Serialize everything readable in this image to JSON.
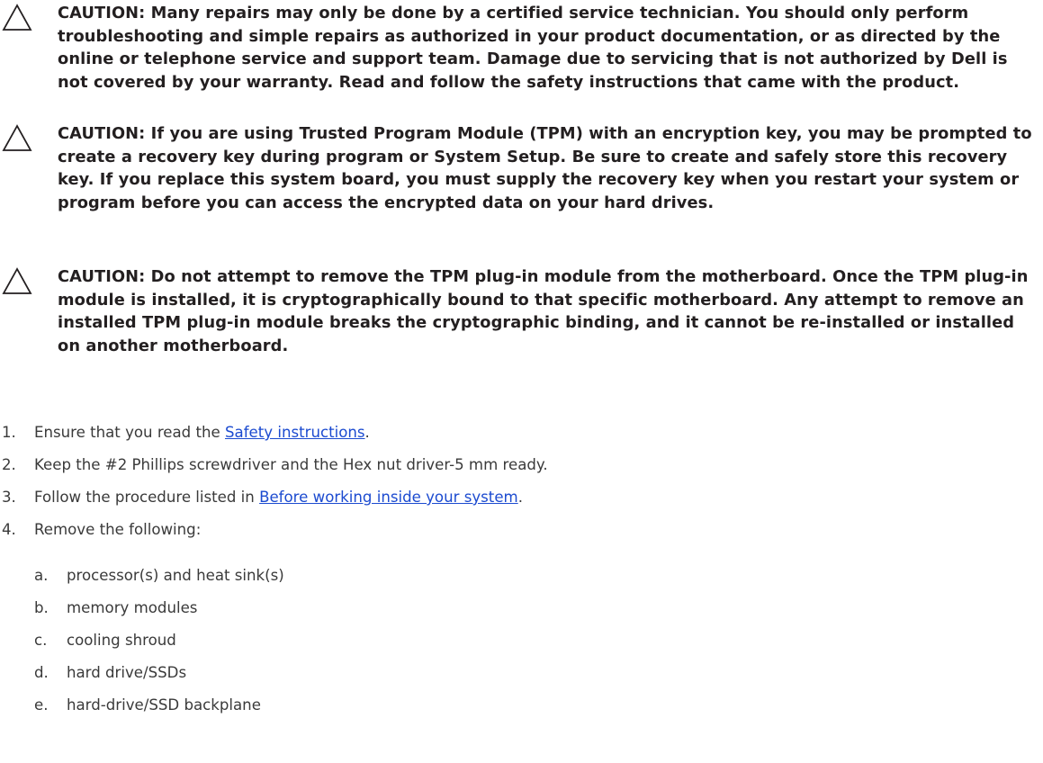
{
  "cautions": [
    {
      "icon": "caution-triangle-icon",
      "text": "CAUTION: Many repairs may only be done by a certified service technician. You should only perform troubleshooting and simple repairs as authorized in your product documentation, or as directed by the online or telephone service and support team. Damage due to servicing that is not authorized by Dell is not covered by your warranty. Read and follow the safety instructions that came with the product."
    },
    {
      "icon": "caution-triangle-icon",
      "text": "CAUTION: If you are using Trusted Program Module (TPM) with an encryption key, you may be prompted to create a recovery key during program or System Setup. Be sure to create and safely store this recovery key. If you replace this system board, you must supply the recovery key when you restart your system or program before you can access the encrypted data on your hard drives."
    },
    {
      "icon": "caution-triangle-icon",
      "text": "CAUTION: Do not attempt to remove the TPM plug-in module from the motherboard. Once the TPM plug-in module is installed, it is cryptographically bound to that specific motherboard. Any attempt to remove an installed TPM plug-in module breaks the cryptographic binding, and it cannot be re-installed or installed on another motherboard."
    }
  ],
  "steps": [
    {
      "num": "1.",
      "before": "Ensure that you read the ",
      "link": "Safety instructions",
      "after": "."
    },
    {
      "num": "2.",
      "text": "Keep the #2 Phillips screwdriver and the Hex nut driver-5 mm ready."
    },
    {
      "num": "3.",
      "before": "Follow the procedure listed in ",
      "link": "Before working inside your system",
      "after": "."
    },
    {
      "num": "4.",
      "text": "Remove the following:"
    }
  ],
  "substeps": [
    {
      "num": "a.",
      "text": "processor(s) and heat sink(s)"
    },
    {
      "num": "b.",
      "text": "memory modules"
    },
    {
      "num": "c.",
      "text": "cooling shroud"
    },
    {
      "num": "d.",
      "text": "hard drive/SSDs"
    },
    {
      "num": "e.",
      "text": "hard-drive/SSD backplane"
    }
  ],
  "colors": {
    "text": "#231f20",
    "body_text": "#3a3a3a",
    "link": "#1c4bd0"
  }
}
